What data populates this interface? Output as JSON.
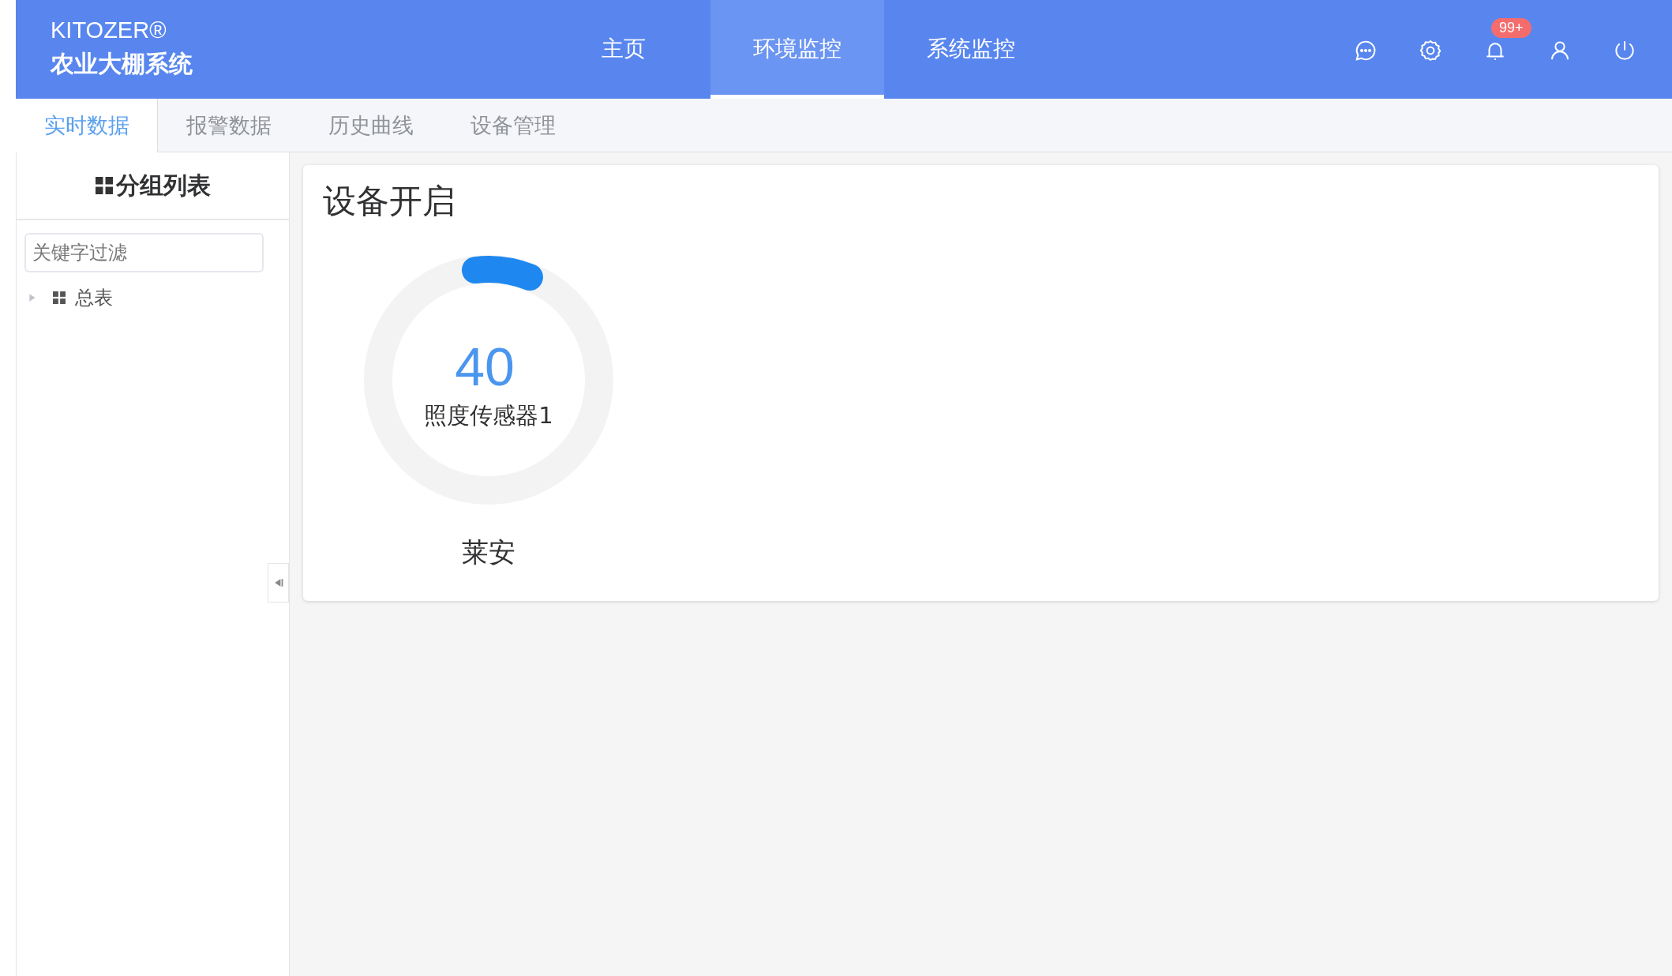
{
  "logo": {
    "brand": "KITOZER®",
    "title": "农业大棚系统"
  },
  "nav": [
    {
      "label": "主页",
      "selected": false
    },
    {
      "label": "环境监控",
      "selected": true
    },
    {
      "label": "系统监控",
      "selected": false
    }
  ],
  "notifications": {
    "badge": "99+"
  },
  "subtabs": [
    {
      "label": "实时数据",
      "selected": true
    },
    {
      "label": "报警数据",
      "selected": false
    },
    {
      "label": "历史曲线",
      "selected": false
    },
    {
      "label": "设备管理",
      "selected": false
    }
  ],
  "sidebar": {
    "title": "分组列表",
    "search": {
      "placeholder": "关键字过滤"
    },
    "tree": [
      {
        "label": "总表",
        "expanded": false
      }
    ]
  },
  "panel": {
    "title": "设备开启",
    "gauges": [
      {
        "value": "40",
        "name": "照度传感器1",
        "level": 0.08,
        "caption": "莱安"
      }
    ]
  }
}
